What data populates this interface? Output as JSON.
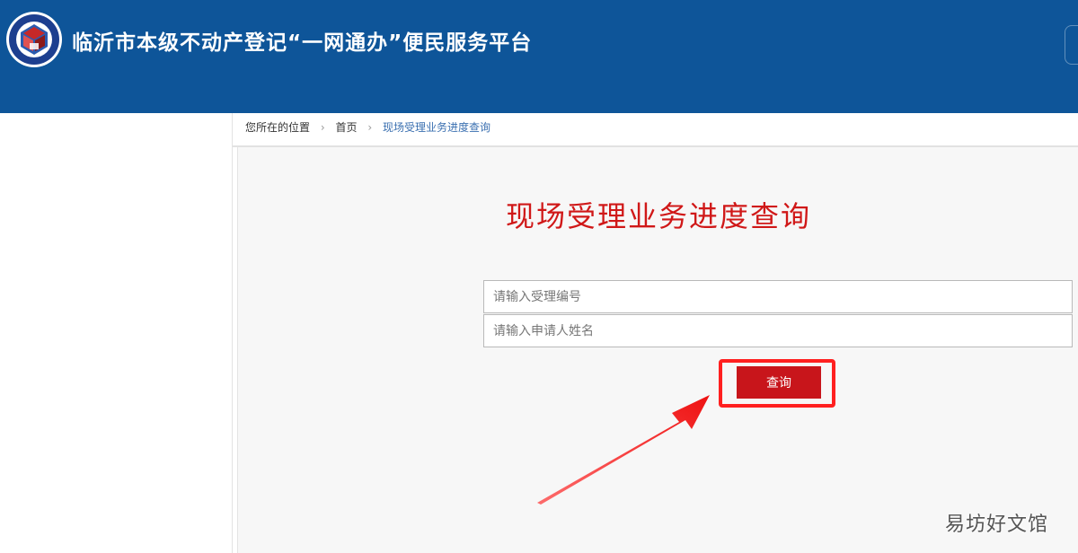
{
  "header": {
    "site_title": "临沂市本级不动产登记“一网通办”便民服务平台",
    "background_color": "#0e5599",
    "logo_icon": "real-estate-registration-emblem-icon"
  },
  "breadcrumb": {
    "prefix": "您所在的位置",
    "home": "首页",
    "current": "现场受理业务进度查询",
    "separator_icon": "chevron-right-icon"
  },
  "main": {
    "heading": "现场受理业务进度查询",
    "heading_color": "#d01818",
    "fields": [
      {
        "value": "",
        "placeholder": "请输入受理编号"
      },
      {
        "value": "",
        "placeholder": "请输入申请人姓名"
      }
    ],
    "query_button_label": "查询",
    "button_color": "#c8151b",
    "annotation": {
      "highlight_color": "#ff2020",
      "arrow_icon": "red-arrow-icon"
    }
  },
  "watermark": "易坊好文馆"
}
